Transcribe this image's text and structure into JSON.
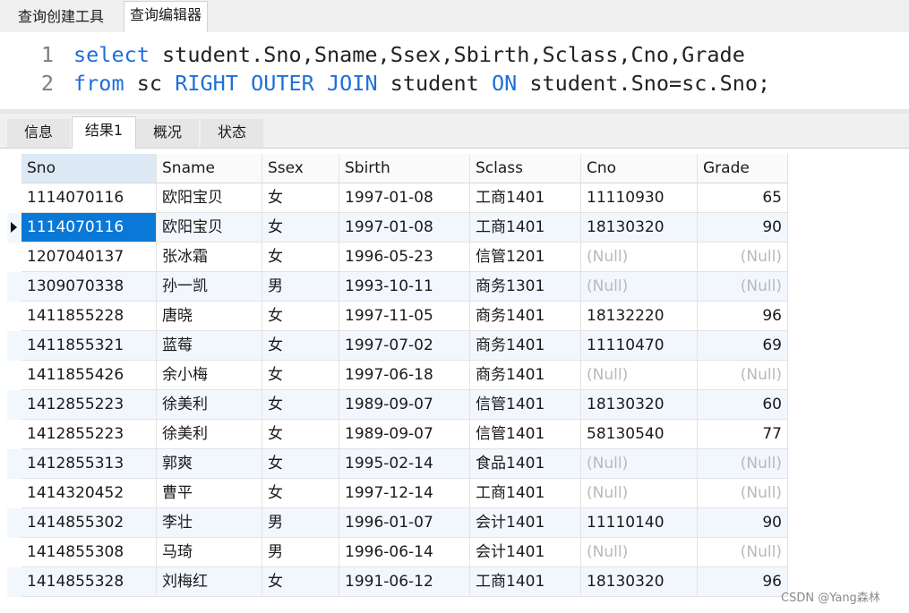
{
  "top_tabs": [
    "查询创建工具",
    "查询编辑器"
  ],
  "editor": {
    "lines": [
      {
        "num": "1",
        "tokens": [
          [
            "kw",
            "select"
          ],
          [
            "t",
            " student.Sno,Sname,Ssex,Sbirth,Sclass,Cno,Grade"
          ]
        ]
      },
      {
        "num": "2",
        "tokens": [
          [
            "kw",
            "from"
          ],
          [
            "t",
            " sc "
          ],
          [
            "kw",
            "RIGHT"
          ],
          [
            "t",
            " "
          ],
          [
            "kw",
            "OUTER"
          ],
          [
            "t",
            " "
          ],
          [
            "kw",
            "JOIN"
          ],
          [
            "t",
            " student "
          ],
          [
            "kw",
            "ON"
          ],
          [
            "t",
            " student.Sno=sc.Sno;"
          ]
        ]
      }
    ]
  },
  "result_tabs": [
    "信息",
    "结果1",
    "概况",
    "状态"
  ],
  "grid": {
    "columns": [
      "Sno",
      "Sname",
      "Ssex",
      "Sbirth",
      "Sclass",
      "Cno",
      "Grade"
    ],
    "rows": [
      [
        "1114070116",
        "欧阳宝贝",
        "女",
        "1997-01-08",
        "工商1401",
        "11110930",
        "65"
      ],
      [
        "1114070116",
        "欧阳宝贝",
        "女",
        "1997-01-08",
        "工商1401",
        "18130320",
        "90"
      ],
      [
        "1207040137",
        "张冰霜",
        "女",
        "1996-05-23",
        "信管1201",
        "(Null)",
        "(Null)"
      ],
      [
        "1309070338",
        "孙一凯",
        "男",
        "1993-10-11",
        "商务1301",
        "(Null)",
        "(Null)"
      ],
      [
        "1411855228",
        "唐晓",
        "女",
        "1997-11-05",
        "商务1401",
        "18132220",
        "96"
      ],
      [
        "1411855321",
        "蓝莓",
        "女",
        "1997-07-02",
        "商务1401",
        "11110470",
        "69"
      ],
      [
        "1411855426",
        "余小梅",
        "女",
        "1997-06-18",
        "商务1401",
        "(Null)",
        "(Null)"
      ],
      [
        "1412855223",
        "徐美利",
        "女",
        "1989-09-07",
        "信管1401",
        "18130320",
        "60"
      ],
      [
        "1412855223",
        "徐美利",
        "女",
        "1989-09-07",
        "信管1401",
        "58130540",
        "77"
      ],
      [
        "1412855313",
        "郭爽",
        "女",
        "1995-02-14",
        "食品1401",
        "(Null)",
        "(Null)"
      ],
      [
        "1414320452",
        "曹平",
        "女",
        "1997-12-14",
        "工商1401",
        "(Null)",
        "(Null)"
      ],
      [
        "1414855302",
        "李壮",
        "男",
        "1996-01-07",
        "会计1401",
        "11110140",
        "90"
      ],
      [
        "1414855308",
        "马琦",
        "男",
        "1996-06-14",
        "会计1401",
        "(Null)",
        "(Null)"
      ],
      [
        "1414855328",
        "刘梅红",
        "女",
        "1991-06-12",
        "工商1401",
        "18130320",
        "96"
      ]
    ],
    "selected_row": 1
  },
  "watermark": "CSDN @Yang森林"
}
